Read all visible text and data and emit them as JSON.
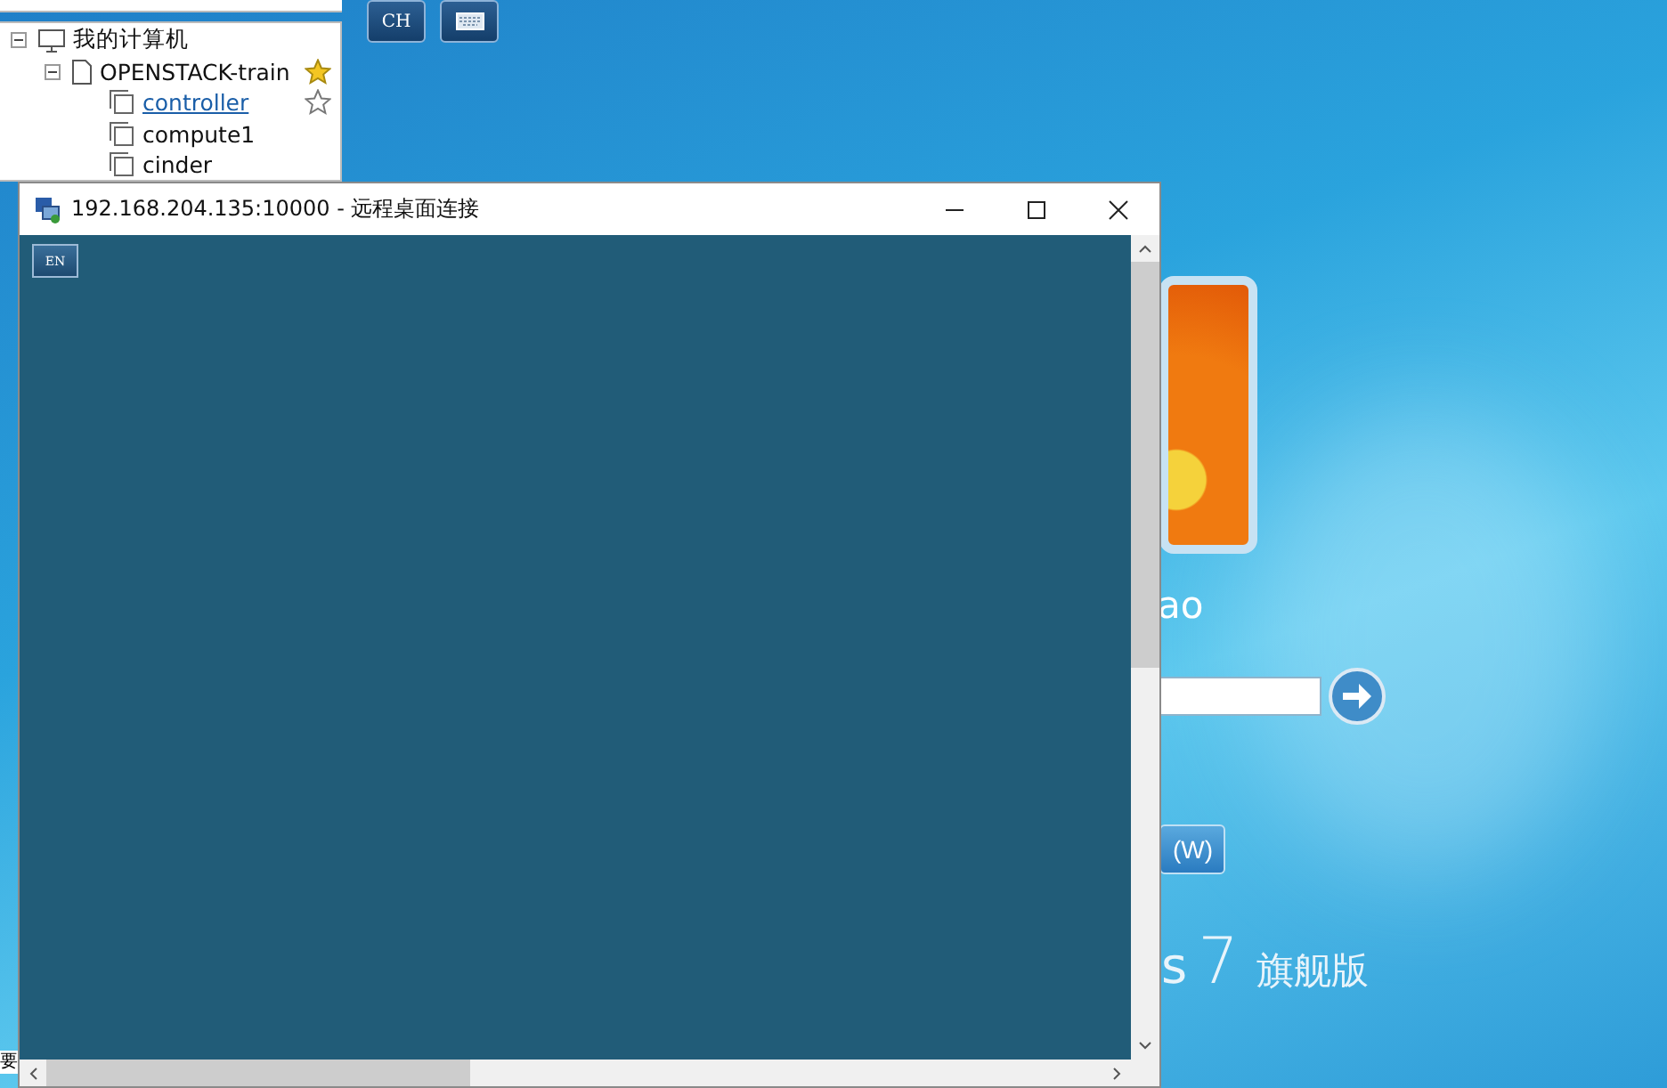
{
  "tree": {
    "items": [
      {
        "label": "我的计算机",
        "expanded": true,
        "children": [
          {
            "label": "OPENSTACK-train",
            "expanded": true,
            "starred": true,
            "children": [
              {
                "label": "controller",
                "selected": true,
                "starred": false
              },
              {
                "label": "compute1",
                "selected": false
              },
              {
                "label": "cinder",
                "selected": false
              }
            ]
          }
        ]
      }
    ]
  },
  "toolbar": [
    {
      "kind": "text",
      "label": "CH"
    },
    {
      "kind": "keyboard"
    }
  ],
  "rdp_window": {
    "title": "192.168.204.135:10000 - 远程桌面连接",
    "language_button": "EN"
  },
  "login_screen": {
    "user_name": "ao",
    "switch_button": "(W)",
    "brand": "s",
    "version": "7",
    "edition": "旗舰版"
  },
  "clipped_text": "要"
}
